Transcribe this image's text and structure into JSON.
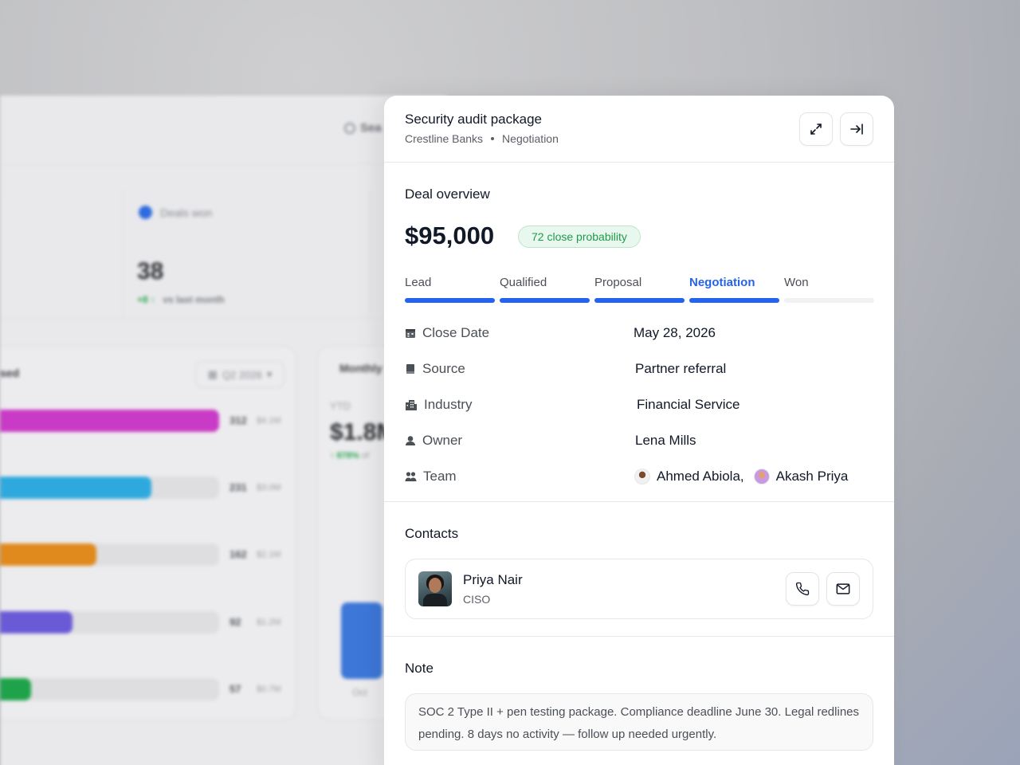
{
  "background": {
    "search_label": "Sea",
    "stat": {
      "label": "Deals won",
      "value": "38",
      "delta": "+8 ↑",
      "delta_text": "vs last month"
    },
    "bars_title": "sed",
    "period_select": "Q2 2026",
    "bars": [
      {
        "count": "312",
        "amount": "$4.1M",
        "color": "#c93bc6",
        "fill": 1.0
      },
      {
        "count": "231",
        "amount": "$3.0M",
        "color": "#2fa9dd",
        "fill": 0.69
      },
      {
        "count": "162",
        "amount": "$2.1M",
        "color": "#e08a1e",
        "fill": 0.44
      },
      {
        "count": "92",
        "amount": "$1.2M",
        "color": "#6b5ad6",
        "fill": 0.33
      },
      {
        "count": "57",
        "amount": "$0.7M",
        "color": "#1fa34a",
        "fill": 0.14
      }
    ],
    "monthly_title": "Monthly",
    "ytd_label": "YTD",
    "ytd_value": "$1.8M",
    "ytd_delta": "↑ 878%",
    "ytd_delta_tail": "of",
    "month_label": "Oct"
  },
  "header": {
    "title": "Security audit package",
    "company": "Crestline Banks",
    "stage": "Negotiation"
  },
  "overview": {
    "title": "Deal overview",
    "amount": "$95,000",
    "probability": "72 close probability"
  },
  "stages": [
    {
      "label": "Lead",
      "state": "done"
    },
    {
      "label": "Qualified",
      "state": "done"
    },
    {
      "label": "Proposal",
      "state": "done"
    },
    {
      "label": "Negotiation",
      "state": "active"
    },
    {
      "label": "Won",
      "state": "pending"
    }
  ],
  "details": {
    "close_date": {
      "label": "Close Date",
      "value": "May 28, 2026"
    },
    "source": {
      "label": "Source",
      "value": "Partner referral"
    },
    "industry": {
      "label": "Industry",
      "value": "Financial Service"
    },
    "owner": {
      "label": "Owner",
      "value": "Lena Mills"
    },
    "team": {
      "label": "Team",
      "member1": "Ahmed Abiola,",
      "member2": "Akash Priya"
    }
  },
  "contacts": {
    "title": "Contacts",
    "name": "Priya Nair",
    "role": "CISO"
  },
  "note": {
    "title": "Note",
    "text": "SOC 2 Type II + pen testing package. Compliance deadline June 30. Legal redlines pending. 8 days no activity — follow up needed urgently."
  },
  "colors": {
    "accent": "#2563eb",
    "success": "#1f9a4a",
    "success_bg": "#e9f8ee"
  }
}
